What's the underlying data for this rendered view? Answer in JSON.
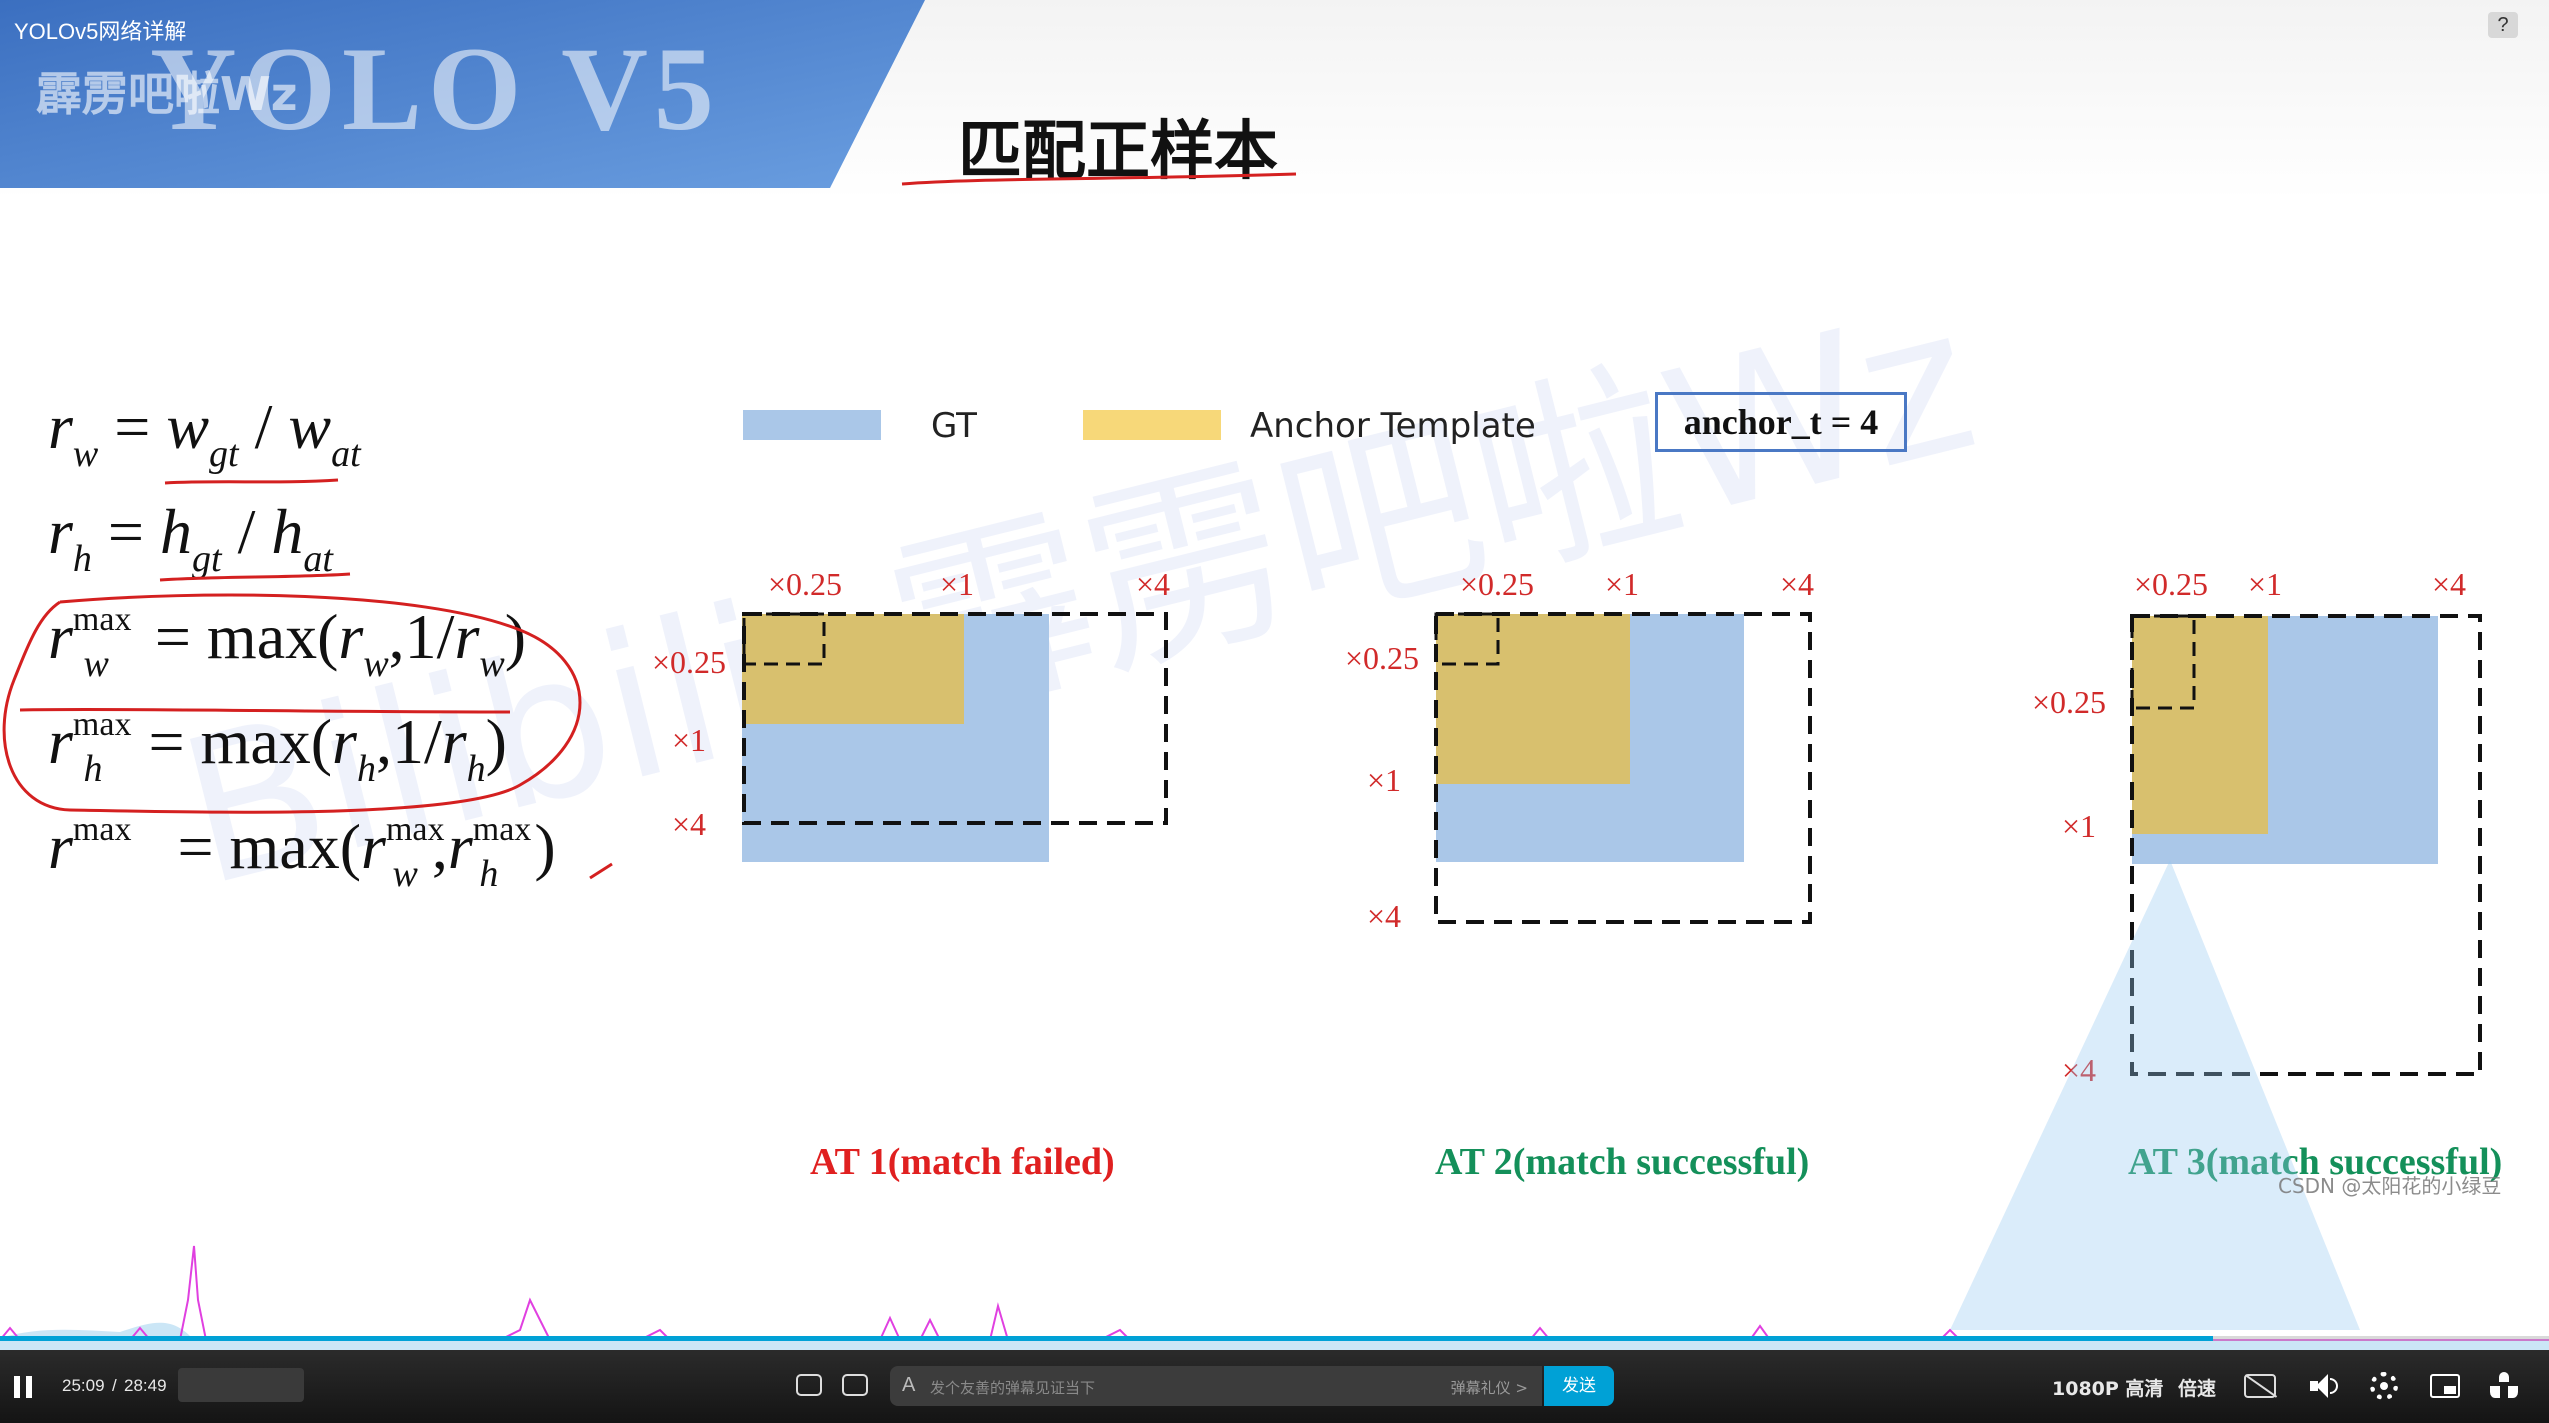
{
  "video": {
    "title": "YOLOv5网络详解",
    "help_label": "?"
  },
  "slide": {
    "banner_text": "YOLO V5",
    "heading": "匹配正样本",
    "watermark_overlay": "霹雳吧啦Wz",
    "watermark_bilibili": "Bilibili: 霹雳吧啦Wz",
    "csdn_watermark": "CSDN @太阳花的小绿豆"
  },
  "formulas": {
    "rw": {
      "lhs_var": "r",
      "lhs_sub": "w",
      "eq": "=",
      "a": "w",
      "a_sub": "gt",
      "slash": "/",
      "b": "w",
      "b_sub": "at"
    },
    "rh": {
      "lhs_var": "r",
      "lhs_sub": "h",
      "eq": "=",
      "a": "h",
      "a_sub": "gt",
      "slash": "/",
      "b": "h",
      "b_sub": "at"
    },
    "rwmax": {
      "var": "r",
      "sub": "w",
      "sup": "max",
      "rhs_pre": "= max(",
      "r": "r",
      "r_sub": "w",
      "mid": ",1/",
      "r2": "r",
      "r2_sub": "w",
      "close": ")"
    },
    "rhmax": {
      "var": "r",
      "sub": "h",
      "sup": "max",
      "rhs_pre": "= max(",
      "r": "r",
      "r_sub": "h",
      "mid": ",1/",
      "r2": "r",
      "r2_sub": "h",
      "close": ")"
    },
    "rmax": {
      "var": "r",
      "sup": "max",
      "rhs_pre": "= max(",
      "a": "r",
      "a_sub": "w",
      "a_sup": "max",
      "comma": ",",
      "b": "r",
      "b_sub": "h",
      "b_sup": "max",
      "close": ")"
    }
  },
  "legend": {
    "gt_label": "GT",
    "anchor_label": "Anchor Template",
    "threshold": "anchor_t = 4",
    "gt_color": "#aac7e8",
    "anchor_color": "#d8c06e"
  },
  "diagrams": [
    {
      "scale_top": [
        "×0.25",
        "×1",
        "×4"
      ],
      "scale_left": [
        "×0.25",
        "×1",
        "×4"
      ],
      "caption": "AT 1(match failed)",
      "caption_color": "#e02020"
    },
    {
      "scale_top": [
        "×0.25",
        "×1",
        "×4"
      ],
      "scale_left": [
        "×0.25",
        "×1",
        "×4"
      ],
      "caption": "AT 2(match successful)",
      "caption_color": "#14905a"
    },
    {
      "scale_top": [
        "×0.25",
        "×1",
        "×4"
      ],
      "scale_left": [
        "×0.25",
        "×1",
        "×4"
      ],
      "caption": "AT 3(match successful)",
      "caption_color": "#14905a"
    }
  ],
  "player": {
    "play_icon": "pause-icon",
    "current_time": "25:09",
    "separator": "/",
    "total_time": "28:49",
    "progress_fraction": 0.868,
    "danmaku_placeholder": "发个友善的弹幕见证当下",
    "danmaku_etiquette": "弹幕礼仪 >",
    "send_label": "发送",
    "quality_label": "1080P 高清",
    "speed_label": "倍速",
    "accent_color": "#00a1d6"
  }
}
